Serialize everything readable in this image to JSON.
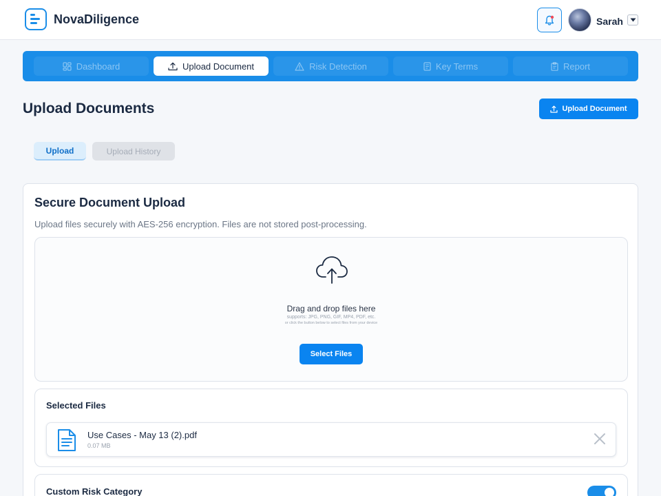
{
  "header": {
    "brand": "NovaDiligence",
    "user_name": "Sarah"
  },
  "nav": {
    "tabs": [
      {
        "label": "Dashboard",
        "icon": "grid-icon",
        "active": false
      },
      {
        "label": "Upload Document",
        "icon": "upload-icon",
        "active": true
      },
      {
        "label": "Risk Detection",
        "icon": "warning-icon",
        "active": false
      },
      {
        "label": "Key Terms",
        "icon": "document-icon",
        "active": false
      },
      {
        "label": "Report",
        "icon": "clipboard-icon",
        "active": false
      }
    ]
  },
  "page": {
    "title": "Upload Documents",
    "upload_button": "Upload Document"
  },
  "subtabs": {
    "upload": "Upload",
    "history": "Upload History"
  },
  "card": {
    "title": "Secure Document Upload",
    "subtitle": "Upload files securely with AES-256 encryption. Files are not stored post-processing."
  },
  "dropzone": {
    "title": "Drag and drop files here",
    "supports": "supports: JPG, PNG, GIF, MP4, PDF, etc.",
    "hint": "or click the button below to select files from your device",
    "button": "Select Files"
  },
  "selected_files": {
    "title": "Selected Files",
    "files": [
      {
        "name": "Use Cases - May 13 (2).pdf",
        "size": "0.07 MB"
      }
    ]
  },
  "risk": {
    "title": "Custom Risk Category",
    "enabled": true
  },
  "colors": {
    "accent": "#1a8de8",
    "primary_button": "#0a84f0"
  }
}
